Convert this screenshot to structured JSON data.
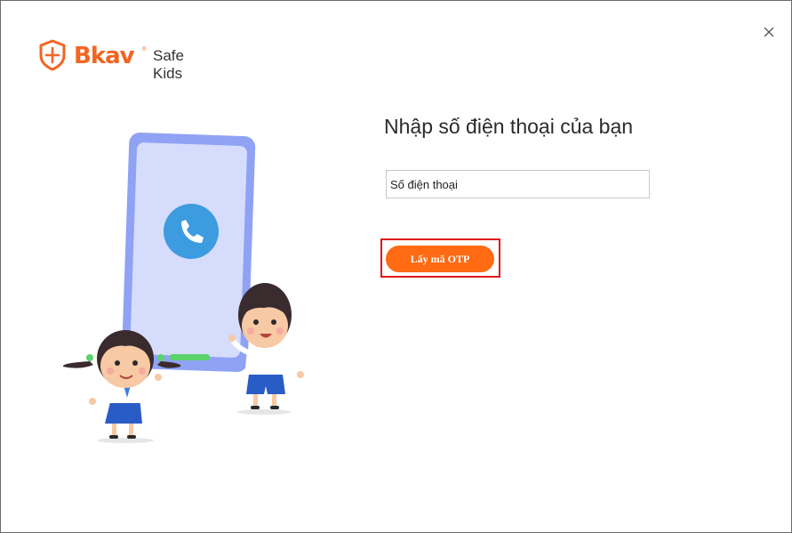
{
  "brand": {
    "name": "Bkav",
    "registered_mark": "®",
    "product": "Safe Kids",
    "logo_icon": "shield-plus-icon"
  },
  "window": {
    "close_icon": "close-icon"
  },
  "form": {
    "title": "Nhập số điện thoại của bạn",
    "phone_placeholder": "Số điện thoại",
    "otp_button_label": "Lấy mã OTP"
  },
  "colors": {
    "brand_orange": "#f26522",
    "button_orange": "#ff6a13",
    "highlight_red": "#e0141a",
    "phone_body": "#8fa2f4",
    "phone_screen": "#d6ddfc",
    "call_circle": "#3d9be0"
  }
}
